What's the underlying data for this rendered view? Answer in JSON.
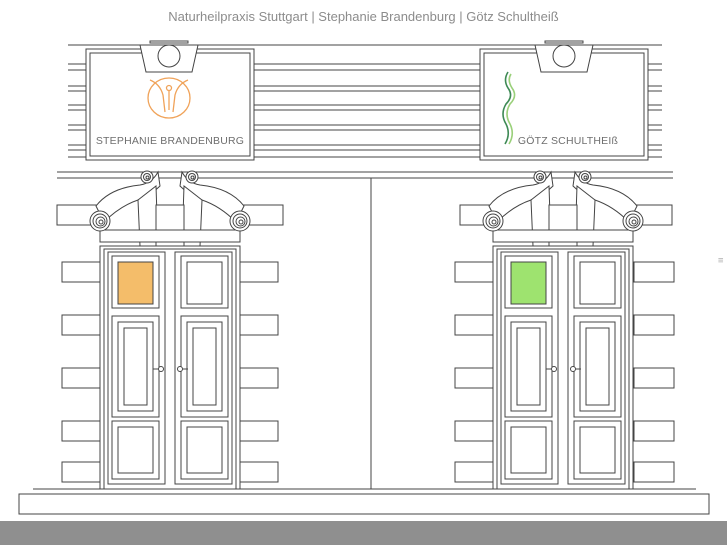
{
  "page": {
    "title": "Naturheilpraxis Stuttgart | Stephanie Brandenburg | Götz Schultheiß"
  },
  "signs": {
    "left": {
      "label": "STEPHANIE BRANDENBURG",
      "logo_icon": "human-figure-circle-icon",
      "logo_color": "#f0a35a"
    },
    "right": {
      "label": "GÖTZ SCHULTHEIß",
      "logo_icon": "spine-figure-icon",
      "logo_color": "#3e8a55"
    }
  },
  "doors": {
    "left": {
      "accent_color": "#f4bd6a",
      "icon": "orange-square"
    },
    "right": {
      "accent_color": "#9ee36f",
      "icon": "green-square"
    }
  },
  "colors": {
    "line": "#444444",
    "status_bar": "#8f8f8f",
    "title_text": "#8c8c8c"
  }
}
